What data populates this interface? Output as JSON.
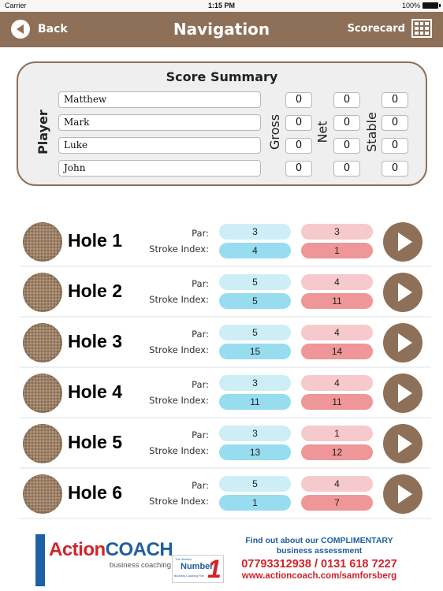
{
  "status_bar": {
    "carrier": "Carrier",
    "time": "1:15 PM",
    "battery": "100%"
  },
  "nav": {
    "back_label": "Back",
    "title": "Navigation",
    "scorecard_label": "Scorecard"
  },
  "summary": {
    "title": "Score Summary",
    "player_label": "Player",
    "columns": [
      "Gross",
      "Net",
      "Stable"
    ],
    "players": [
      {
        "name": "Matthew",
        "gross": "0",
        "net": "0",
        "stable": "0"
      },
      {
        "name": "Mark",
        "gross": "0",
        "net": "0",
        "stable": "0"
      },
      {
        "name": "Luke",
        "gross": "0",
        "net": "0",
        "stable": "0"
      },
      {
        "name": "John",
        "gross": "0",
        "net": "0",
        "stable": "0"
      }
    ]
  },
  "holes": {
    "par_label": "Par:",
    "si_label": "Stroke Index:",
    "items": [
      {
        "name": "Hole 1",
        "par_a": "3",
        "si_a": "4",
        "par_b": "3",
        "si_b": "1"
      },
      {
        "name": "Hole 2",
        "par_a": "5",
        "si_a": "5",
        "par_b": "4",
        "si_b": "11"
      },
      {
        "name": "Hole 3",
        "par_a": "5",
        "si_a": "15",
        "par_b": "4",
        "si_b": "14"
      },
      {
        "name": "Hole 4",
        "par_a": "3",
        "si_a": "11",
        "par_b": "4",
        "si_b": "11"
      },
      {
        "name": "Hole 5",
        "par_a": "3",
        "si_a": "13",
        "par_b": "1",
        "si_b": "12"
      },
      {
        "name": "Hole 6",
        "par_a": "5",
        "si_a": "1",
        "par_b": "4",
        "si_b": "7"
      }
    ]
  },
  "ad": {
    "logo_action": "Action",
    "logo_coach": "COACH",
    "logo_sub": "business coaching",
    "badge_top": "The World's",
    "badge_mid": "Number",
    "badge_one": "1",
    "badge_bottom": "Business Coaching Firm",
    "line1": "Find out about our COMPLIMENTARY",
    "line2": "business assessment",
    "phone": "07793312938 / 0131 618 7227",
    "url": "www.actioncoach.com/samforsberg"
  },
  "colors": {
    "brand": "#8e7058",
    "par_blue_light": "#cdeef7",
    "si_blue": "#98dcf0",
    "par_red_light": "#f6c9cc",
    "si_red": "#ee9698"
  }
}
